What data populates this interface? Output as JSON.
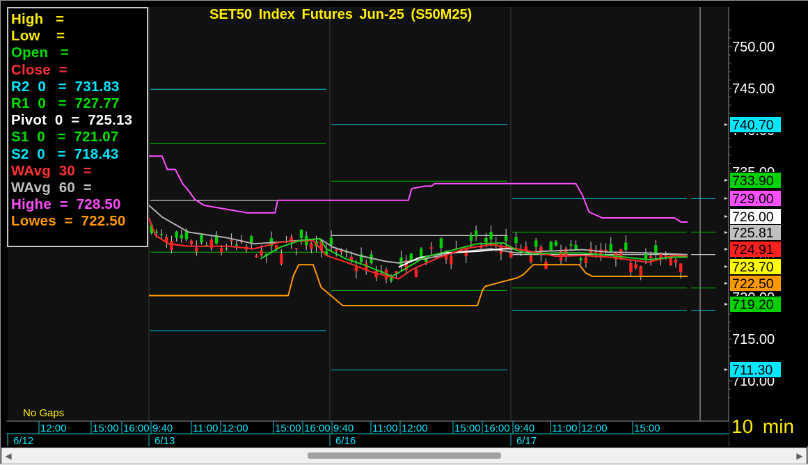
{
  "chart_data": {
    "type": "candlestick",
    "title": "SET50 Index Futures Jun-25 (S50M25)",
    "interval_label": "10 min",
    "gaps_label": "No Gaps",
    "y_ticks": [
      750.0,
      745.0,
      740.0,
      735.0,
      730.0,
      725.0,
      720.0,
      715.0,
      710.0
    ],
    "y_tick_labels": [
      "750.00",
      "745.00",
      "740.00",
      "735.00",
      "730.00",
      "725.00",
      "720.00",
      "715.00",
      "710.00"
    ],
    "time_labels": [
      "12:00",
      "15:00",
      "16:00",
      "9:40",
      "11:00",
      "12:00",
      "15:00",
      "16:00",
      "9:40",
      "11:00",
      "12:00",
      "15:00",
      "16:00",
      "9:40",
      "11:00",
      "12:00",
      "15:00"
    ],
    "date_labels": [
      "6/12",
      "6/13",
      "6/16",
      "6/17"
    ],
    "legend": [
      {
        "label": "High   =",
        "color": "#ffee00"
      },
      {
        "label": "Low    =",
        "color": "#ffee00"
      },
      {
        "label": "Open   =",
        "color": "#00e000"
      },
      {
        "label": "Close  =",
        "color": "#ff3030"
      },
      {
        "label": "R2  0   =  731.83",
        "color": "#00e8ff"
      },
      {
        "label": "R1  0   =  727.77",
        "color": "#00e000"
      },
      {
        "label": "Pivot  0  =  725.13",
        "color": "#ffffff"
      },
      {
        "label": "S1  0   =  721.07",
        "color": "#00e000"
      },
      {
        "label": "S2  0   =  718.43",
        "color": "#00e8ff"
      },
      {
        "label": "WAvg  30  =",
        "color": "#ff3030"
      },
      {
        "label": "WAvg  60  =",
        "color": "#c0c0c0"
      },
      {
        "label": "Highe  =  728.50",
        "color": "#ff50ff"
      },
      {
        "label": "Lowes  =  722.50",
        "color": "#ff9900"
      }
    ],
    "price_badges": [
      {
        "label": "740.70",
        "value": 740.7,
        "bg": "#00e8ff",
        "fg": "#000000"
      },
      {
        "label": "733.90",
        "value": 733.9,
        "bg": "#00d000",
        "fg": "#000000"
      },
      {
        "label": "729.00",
        "value": 729.0,
        "bg": "#ff50ff",
        "fg": "#000000"
      },
      {
        "label": "726.00",
        "value": 726.0,
        "bg": "#ffffff",
        "fg": "#000000"
      },
      {
        "label": "725.81",
        "value": 725.81,
        "bg": "#c0c0c0",
        "fg": "#000000"
      },
      {
        "label": "724.91",
        "value": 724.91,
        "bg": "#ff2020",
        "fg": "#000000"
      },
      {
        "label": "723.70",
        "value": 723.7,
        "bg": "#ffff00",
        "fg": "#000000"
      },
      {
        "label": "722.50",
        "value": 722.5,
        "bg": "#ff9900",
        "fg": "#000000"
      },
      {
        "label": "719.20",
        "value": 719.2,
        "bg": "#00d000",
        "fg": "#000000"
      },
      {
        "label": "711.30",
        "value": 711.3,
        "bg": "#00e8ff",
        "fg": "#000000"
      }
    ],
    "pivot_levels": {
      "day1": {
        "R2": 746.4,
        "R1": 737.0,
        "P": 728.9,
        "S1": 724.1,
        "S2": 720.2
      },
      "day2": {
        "R2": 744.9,
        "R1": 738.4,
        "P": 731.6,
        "S1": 725.4,
        "S2": 716.0
      },
      "day3": {
        "R2": 740.7,
        "R1": 733.9,
        "P": 727.4,
        "S1": 720.8,
        "S2": 711.3
      },
      "day4": {
        "R2": 731.8,
        "R1": 727.8,
        "P": 725.1,
        "S1": 721.1,
        "S2": 718.4
      }
    },
    "highe_line": [
      [
        0,
        736.9
      ],
      [
        20,
        736.9
      ],
      [
        28,
        735.3
      ],
      [
        40,
        735.3
      ],
      [
        52,
        733.5
      ],
      [
        58,
        733.0
      ],
      [
        70,
        731.7
      ],
      [
        84,
        731.0
      ],
      [
        150,
        730.1
      ],
      [
        192,
        730.1
      ],
      [
        196,
        731.6
      ],
      [
        260,
        731.6
      ],
      [
        395,
        731.6
      ],
      [
        400,
        733.0
      ],
      [
        420,
        733.3
      ],
      [
        430,
        733.3
      ],
      [
        435,
        733.6
      ],
      [
        650,
        733.6
      ],
      [
        660,
        732.2
      ],
      [
        670,
        730.2
      ],
      [
        690,
        729.5
      ],
      [
        800,
        729.5
      ],
      [
        810,
        729.0
      ],
      [
        820,
        729.0
      ]
    ],
    "lowes_line": [
      [
        0,
        720.2
      ],
      [
        212,
        720.2
      ],
      [
        220,
        722.6
      ],
      [
        228,
        723.9
      ],
      [
        250,
        723.9
      ],
      [
        262,
        721.2
      ],
      [
        295,
        719.0
      ],
      [
        500,
        719.0
      ],
      [
        508,
        720.9
      ],
      [
        512,
        721.3
      ],
      [
        540,
        721.9
      ],
      [
        560,
        722.3
      ],
      [
        570,
        722.7
      ],
      [
        585,
        723.9
      ],
      [
        655,
        723.9
      ],
      [
        665,
        722.9
      ],
      [
        675,
        722.5
      ],
      [
        820,
        722.5
      ]
    ],
    "wavg30_line": [
      [
        0,
        729.5
      ],
      [
        10,
        727.4
      ],
      [
        30,
        726.4
      ],
      [
        60,
        726.1
      ],
      [
        120,
        726.1
      ],
      [
        160,
        725.8
      ],
      [
        200,
        726.6
      ],
      [
        250,
        726.8
      ],
      [
        270,
        725.0
      ],
      [
        300,
        724.2
      ],
      [
        340,
        723.0
      ],
      [
        380,
        722.2
      ],
      [
        400,
        723.3
      ],
      [
        440,
        724.7
      ],
      [
        480,
        725.8
      ],
      [
        520,
        726.3
      ],
      [
        560,
        725.8
      ],
      [
        600,
        725.2
      ],
      [
        620,
        724.9
      ],
      [
        660,
        725.0
      ],
      [
        700,
        724.8
      ],
      [
        760,
        724.2
      ],
      [
        800,
        725.0
      ],
      [
        820,
        724.9
      ]
    ],
    "wavg60_line": [
      [
        0,
        731.0
      ],
      [
        20,
        729.6
      ],
      [
        60,
        727.8
      ],
      [
        120,
        727.1
      ],
      [
        160,
        726.4
      ],
      [
        200,
        726.6
      ],
      [
        260,
        727.0
      ],
      [
        280,
        726.0
      ],
      [
        320,
        725.0
      ],
      [
        360,
        724.3
      ],
      [
        380,
        724.1
      ],
      [
        420,
        724.6
      ],
      [
        470,
        725.4
      ],
      [
        520,
        725.8
      ],
      [
        560,
        725.3
      ],
      [
        600,
        725.5
      ],
      [
        660,
        725.7
      ],
      [
        700,
        725.4
      ],
      [
        760,
        725.3
      ],
      [
        820,
        725.1
      ]
    ],
    "open_green_line": [
      [
        170,
        724.6
      ],
      [
        200,
        726.0
      ],
      [
        230,
        726.8
      ],
      [
        260,
        727.0
      ],
      [
        270,
        725.8
      ],
      [
        300,
        724.6
      ],
      [
        330,
        723.8
      ],
      [
        370,
        722.5
      ],
      [
        390,
        723.4
      ],
      [
        420,
        724.8
      ],
      [
        460,
        725.6
      ],
      [
        500,
        726.4
      ],
      [
        540,
        726.5
      ],
      [
        560,
        725.6
      ],
      [
        580,
        725.2
      ],
      [
        620,
        725.3
      ],
      [
        660,
        725.3
      ],
      [
        700,
        725.0
      ],
      [
        760,
        724.5
      ],
      [
        800,
        724.8
      ],
      [
        820,
        724.8
      ]
    ],
    "pivot_white_day3": [
      [
        380,
        723.6
      ],
      [
        410,
        724.7
      ],
      [
        450,
        725.3
      ],
      [
        500,
        725.5
      ],
      [
        540,
        725.8
      ],
      [
        560,
        725.8
      ]
    ],
    "candles_hint": "approximate 10-minute OHLC series rendered as candlesticks"
  }
}
